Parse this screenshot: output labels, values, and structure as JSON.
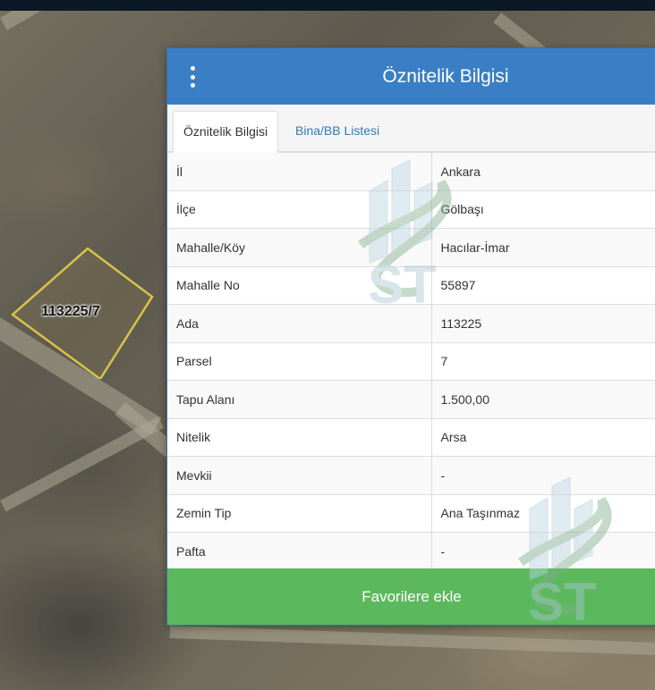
{
  "map": {
    "parcel_label": "113225/7"
  },
  "panel": {
    "title": "Öznitelik Bilgisi",
    "tabs": [
      {
        "label": "Öznitelik Bilgisi",
        "active": true
      },
      {
        "label": "Bina/BB Listesi",
        "active": false
      }
    ],
    "rows": [
      {
        "key": "İl",
        "value": "Ankara"
      },
      {
        "key": "İlçe",
        "value": "Gölbaşı"
      },
      {
        "key": "Mahalle/Köy",
        "value": "Hacılar-İmar"
      },
      {
        "key": "Mahalle No",
        "value": "55897"
      },
      {
        "key": "Ada",
        "value": "113225"
      },
      {
        "key": "Parsel",
        "value": "7"
      },
      {
        "key": "Tapu Alanı",
        "value": "1.500,00"
      },
      {
        "key": "Nitelik",
        "value": "Arsa"
      },
      {
        "key": "Mevkii",
        "value": "-"
      },
      {
        "key": "Zemin Tip",
        "value": "Ana Taşınmaz"
      },
      {
        "key": "Pafta",
        "value": "-"
      }
    ],
    "favorite_button": "Favorilere ekle"
  },
  "colors": {
    "header": "#3a7fc6",
    "button": "#5cb85c",
    "link": "#337ab7",
    "parcel_outline": "#d8c24a"
  },
  "icons": {
    "menu": "vertical-ellipsis-icon",
    "watermark": "st-building-logo"
  }
}
